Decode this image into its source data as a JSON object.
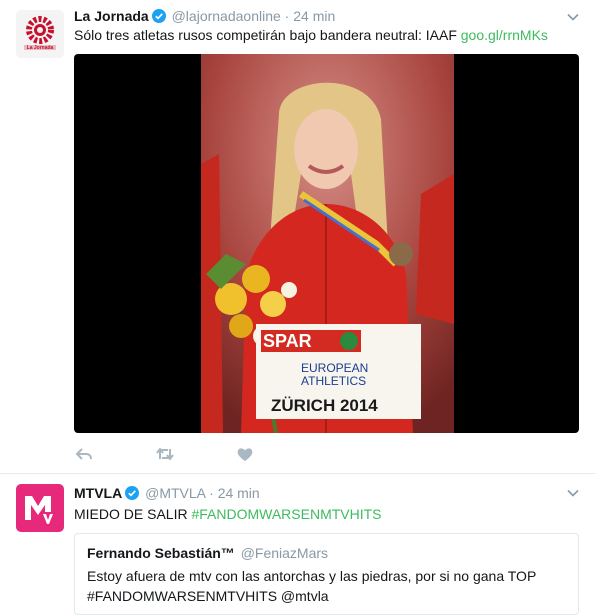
{
  "tweets": [
    {
      "author_name": "La Jornada",
      "author_handle": "@lajornadaonline",
      "time": "24 min",
      "text_prefix": "Sólo tres atletas rusos competirán bajo bandera neutral: IAAF ",
      "link_text": "goo.gl/rrnMKs",
      "avatar_label": "La Jornada",
      "photo_bib_brand": "SPAR",
      "photo_bib_line1": "EUROPEAN",
      "photo_bib_line2": "ATHLETICS",
      "photo_bib_city": "ZÜRICH 2014"
    },
    {
      "author_name": "MTVLA",
      "author_handle": "@MTVLA",
      "time": "24 min",
      "text_prefix": "MIEDO DE SALIR ",
      "hashtag": "#FANDOMWARSENMTVHITS",
      "quote": {
        "author_name": "Fernando Sebastián™",
        "author_handle": "@FeniazMars",
        "line1": "Estoy afuera de mtv con las antorchas y las piedras, por si no gana TOP",
        "line2": "#FANDOMWARSENMTVHITS @mtvla"
      }
    }
  ],
  "colors": {
    "link": "#3dbb5f",
    "meta_text": "#8899a6",
    "verified": "#1da1f2",
    "mtv_pink": "#e6297a",
    "jornada_red": "#c8102e"
  },
  "icons": [
    "chevron-down-icon",
    "verified-icon",
    "reply-icon",
    "retweet-icon",
    "like-icon"
  ]
}
